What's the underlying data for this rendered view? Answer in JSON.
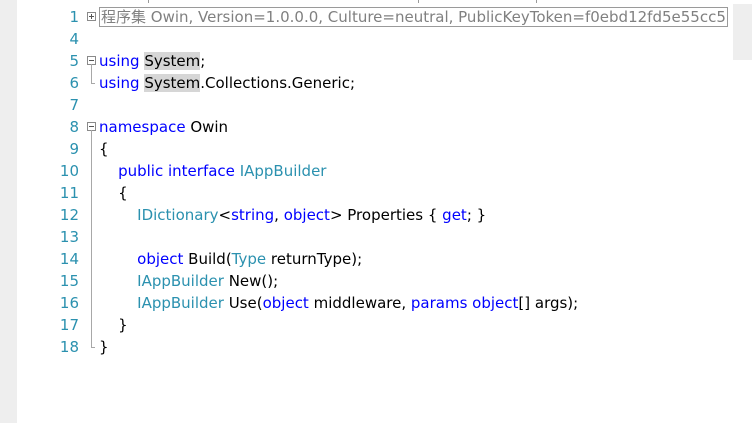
{
  "line_numbers": [
    "1",
    "4",
    "5",
    "6",
    "7",
    "8",
    "9",
    "10",
    "11",
    "12",
    "13",
    "14",
    "15",
    "16",
    "17",
    "18"
  ],
  "colors": {
    "keyword": "#0000ff",
    "type": "#2b91af",
    "text": "#000000",
    "line_number": "#2b91af",
    "collapsed_text": "#808080",
    "highlight": "#d6d6d6"
  },
  "code": {
    "line1": {
      "collapsed": "程序集 Owin, Version=1.0.0.0, Culture=neutral, PublicKeyToken=f0ebd12fd5e55cc5"
    },
    "line5": {
      "kw": "using",
      "ns": "System",
      "end": ";"
    },
    "line6": {
      "kw": "using",
      "ns": "System",
      "rest": ".Collections.Generic;"
    },
    "line8": {
      "kw": "namespace",
      "name": " Owin"
    },
    "line9": {
      "text": "{"
    },
    "line10": {
      "kw1": "public",
      "kw2": "interface",
      "type": "IAppBuilder"
    },
    "line11": {
      "text": "{"
    },
    "line12": {
      "type": "IDictionary",
      "lt": "<",
      "kw1": "string",
      "comma": ", ",
      "kw2": "object",
      "gt": "> Properties { ",
      "kw3": "get",
      "end": "; }"
    },
    "line14": {
      "kw": "object",
      "mid": " Build(",
      "type": "Type",
      "end": " returnType);"
    },
    "line15": {
      "type": "IAppBuilder",
      "end": " New();"
    },
    "line16": {
      "type": "IAppBuilder",
      "mid": " Use(",
      "kw1": "object",
      "mid2": " middleware, ",
      "kw2": "params",
      "sp": " ",
      "kw3": "object",
      "end": "[] args);"
    },
    "line17": {
      "text": "}"
    },
    "line18": {
      "text": "}"
    }
  }
}
